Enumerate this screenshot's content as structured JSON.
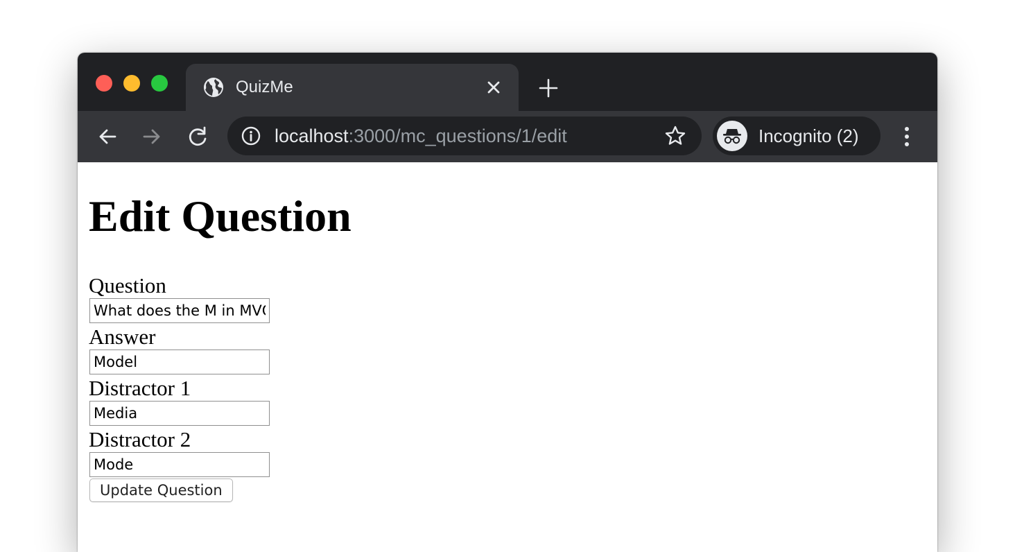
{
  "browser": {
    "tab": {
      "title": "QuizMe",
      "icon": "globe-icon"
    },
    "address_bar": {
      "host": "localhost",
      "path": ":3000/mc_questions/1/edit"
    },
    "profile": {
      "label": "Incognito (2)",
      "icon": "incognito-icon"
    },
    "colors": {
      "frame": "#202124",
      "toolbar": "#35363a",
      "text": "#e8eaed",
      "muted_text": "#9aa0a6"
    }
  },
  "page": {
    "heading": "Edit Question",
    "form": {
      "question_label": "Question",
      "question_value": "What does the M in MVC stand for?",
      "answer_label": "Answer",
      "answer_value": "Model",
      "distractor_1_label": "Distractor 1",
      "distractor_1_value": "Media",
      "distractor_2_label": "Distractor 2",
      "distractor_2_value": "Mode",
      "submit_label": "Update Question"
    }
  }
}
